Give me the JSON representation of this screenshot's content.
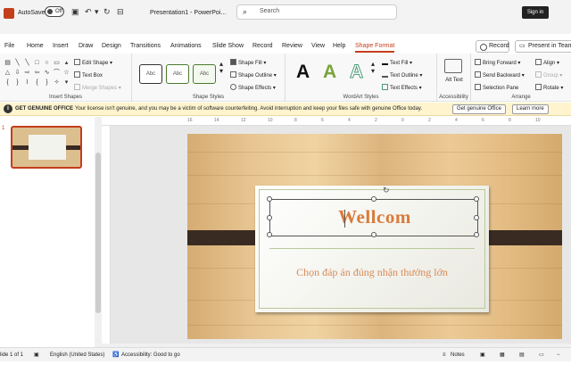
{
  "titlebar": {
    "autosave_label": "AutoSave",
    "autosave_state": "Off",
    "document_title": "Presentation1 - PowerPoi...",
    "search_placeholder": "Search",
    "signin_label": "Sign in"
  },
  "tabs": [
    "File",
    "Home",
    "Insert",
    "Draw",
    "Design",
    "Transitions",
    "Animations",
    "Slide Show",
    "Record",
    "Review",
    "View",
    "Help",
    "Shape Format"
  ],
  "active_tab": "Shape Format",
  "actions": {
    "record": "Record",
    "present": "Present in Teams"
  },
  "ribbon": {
    "insert_shapes": {
      "edit_shape": "Edit Shape",
      "text_box": "Text Box",
      "merge_shapes": "Merge Shapes",
      "label": "Insert Shapes"
    },
    "shape_styles": {
      "style_preview": "Abc",
      "fill": "Shape Fill",
      "outline": "Shape Outline",
      "effects": "Shape Effects",
      "label": "Shape Styles"
    },
    "wordart": {
      "letter": "A",
      "text_fill": "Text Fill",
      "text_outline": "Text Outline",
      "text_effects": "Text Effects",
      "label": "WordArt Styles"
    },
    "accessibility": {
      "alt_text": "Alt Text",
      "label": "Accessibility"
    },
    "arrange": {
      "bring_forward": "Bring Forward",
      "send_backward": "Send Backward",
      "selection_pane": "Selection Pane",
      "align": "Align",
      "group": "Group",
      "rotate": "Rotate",
      "label": "Arrange"
    }
  },
  "notice": {
    "title": "GET GENUINE OFFICE",
    "message": "Your license isn't genuine, and you may be a victim of software counterfeiting. Avoid interruption and keep your files safe with genuine Office today.",
    "primary_button": "Get genuine Office",
    "secondary_button": "Learn more"
  },
  "thumbnail": {
    "slide_number": "1"
  },
  "ruler_numbers": [
    "16",
    "14",
    "12",
    "10",
    "8",
    "6",
    "4",
    "2",
    "0",
    "2",
    "4",
    "6",
    "8",
    "10"
  ],
  "slide": {
    "title": "Wellcom",
    "subtitle": "Chọn đáp án đúng nhận thưởng lớn"
  },
  "status": {
    "slide_info": "lide 1 of 1",
    "language": "English (United States)",
    "accessibility": "Accessibility: Good to go",
    "notes": "Notes"
  },
  "colors": {
    "accent": "#c43e1c",
    "title_text": "#d97b3b",
    "notice_bg": "#fff4ce"
  }
}
